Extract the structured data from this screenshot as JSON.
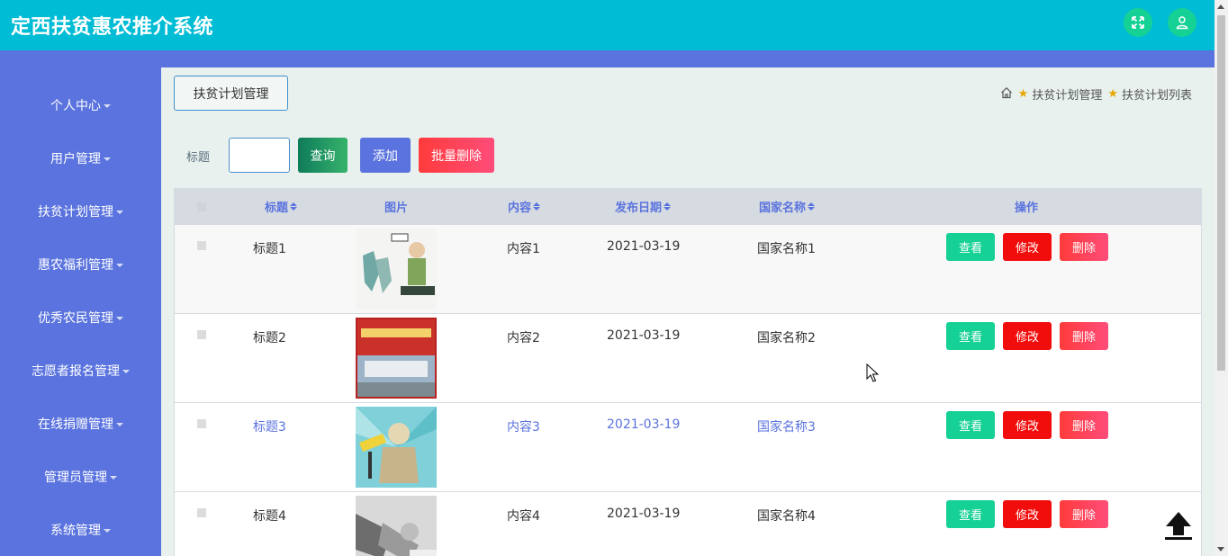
{
  "app": {
    "title": "定西扶贫惠农推介系统"
  },
  "header": {
    "icons": [
      "fullscreen-icon",
      "user-icon"
    ]
  },
  "sidebar": {
    "items": [
      {
        "label": "个人中心"
      },
      {
        "label": "用户管理"
      },
      {
        "label": "扶贫计划管理"
      },
      {
        "label": "惠农福利管理"
      },
      {
        "label": "优秀农民管理"
      },
      {
        "label": "志愿者报名管理"
      },
      {
        "label": "在线捐赠管理"
      },
      {
        "label": "管理员管理"
      },
      {
        "label": "系统管理"
      }
    ]
  },
  "page": {
    "section_button": "扶贫计划管理",
    "breadcrumb": [
      "扶贫计划管理",
      "扶贫计划列表"
    ]
  },
  "search": {
    "label": "标题",
    "value": "",
    "query_label": "查询",
    "add_label": "添加",
    "batch_delete_label": "批量删除"
  },
  "table": {
    "columns": [
      "标题",
      "图片",
      "内容",
      "发布日期",
      "国家名称",
      "操作"
    ],
    "actions": {
      "view": "查看",
      "edit": "修改",
      "delete": "删除"
    },
    "rows": [
      {
        "title": "标题1",
        "content": "内容1",
        "date": "2021-03-19",
        "country": "国家名称1"
      },
      {
        "title": "标题2",
        "content": "内容2",
        "date": "2021-03-19",
        "country": "国家名称2"
      },
      {
        "title": "标题3",
        "content": "内容3",
        "date": "2021-03-19",
        "country": "国家名称3"
      },
      {
        "title": "标题4",
        "content": "内容4",
        "date": "2021-03-19",
        "country": "国家名称4"
      }
    ]
  },
  "colors": {
    "header_bg": "#00bcd4",
    "sidebar_bg": "#5a73de",
    "main_bg": "#e8f1ee",
    "view_button": "#16d196",
    "edit_button": "#f20d0d",
    "delete_button": "#ff4d7a"
  }
}
